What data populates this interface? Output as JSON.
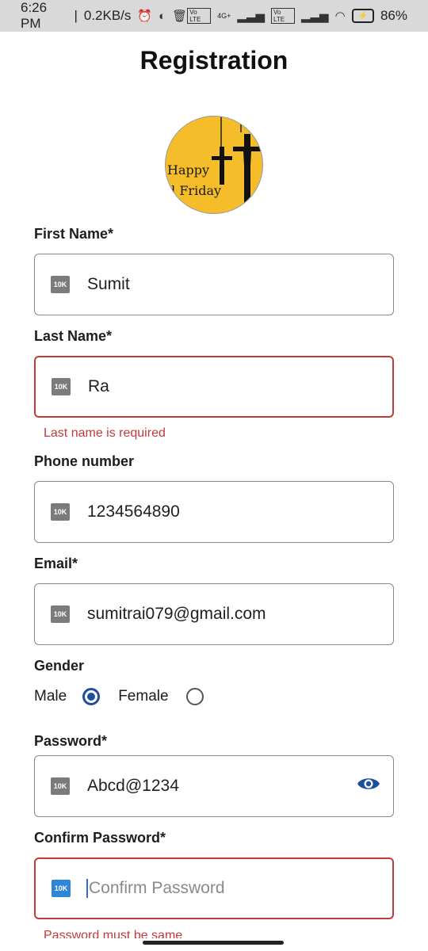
{
  "status": {
    "time": "6:26 PM",
    "speed": "0.2KB/s",
    "battery": "86%",
    "net_1": "4G+",
    "net_2": "Vo LTE"
  },
  "header": {
    "title": "Registration"
  },
  "avatar": {
    "line1": "Happy",
    "line2": "d Friday"
  },
  "form": {
    "first_name": {
      "label": "First Name*",
      "value": "Sumit",
      "badge": "10K"
    },
    "last_name": {
      "label": "Last Name*",
      "value": "Ra",
      "badge": "10K",
      "error": "Last name is required"
    },
    "phone": {
      "label": "Phone number",
      "value": "1234564890",
      "badge": "10K"
    },
    "email": {
      "label": "Email*",
      "value": "sumitrai079@gmail.com",
      "badge": "10K"
    },
    "gender": {
      "label": "Gender",
      "options": [
        "Male",
        "Female"
      ],
      "selected": "Male"
    },
    "password": {
      "label": "Password*",
      "value": "Abcd@1234",
      "badge": "10K"
    },
    "confirm_password": {
      "label": "Confirm Password*",
      "placeholder": "Confirm Password",
      "badge": "10K",
      "error": "Password must be same"
    }
  },
  "colors": {
    "error": "#c23a3a",
    "accent": "#1d4fa0",
    "avatar_bg": "#f6bd2a"
  }
}
